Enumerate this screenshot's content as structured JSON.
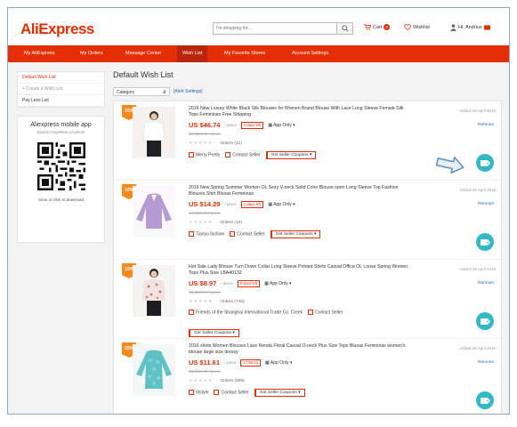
{
  "header": {
    "logo": "AliExpress",
    "search_placeholder": "I'm shopping for...",
    "cart_label": "Cart",
    "cart_count": "0",
    "wishlist_label": "Wishlist",
    "user_label": "Hi, Andrius"
  },
  "nav": {
    "items": [
      "My AliExpress",
      "My Orders",
      "Message Center",
      "Wish List",
      "My Favorite Stores",
      "Account Settings"
    ],
    "active": "Wish List"
  },
  "sidebar": {
    "links": [
      "Default Wish List",
      "+ Create a Wish List",
      "Pay Less List"
    ],
    "app_title": "Aliexpress mobile app",
    "app_subtitle": "Search Anywhere,Anytime!",
    "app_download": "Scan or click to download"
  },
  "main": {
    "title": "Default Wish List",
    "category_label": "Category",
    "alert_settings": "[Alert Settings]",
    "remove_label": "Remove",
    "coupon_label": "Get Seller Coupons",
    "contact_label": "Contact Seller",
    "app_only_label": "App Only",
    "unit_label": "/ piece",
    "colors": {
      "accent": "#e62e04",
      "ribbon": "#f7891a",
      "tag": "#33b8c8",
      "link": "#2364b8"
    },
    "items": [
      {
        "discount": "15%",
        "title": "2016 New Luxury White Black Silk Blouses for Women Brand Blouse With Lace Long Sleeve Female Silk Tops Feminines Free Shipping",
        "price": "US $46.74",
        "days_left": "1 days left",
        "old_price": "US $54.99 / piece",
        "orders": "Orders (12)",
        "store": "Merry Pretty",
        "added": "Added 26 April 2016"
      },
      {
        "discount": "10%",
        "title": "2016 New Spring Summer Women OL Sexy V-neck Solid Color Blouse open Long Sleeve Top Fashion Blouses Shirt Blusas Femininas",
        "price": "US $14.29",
        "days_left": "1 days left",
        "old_price": "US $15.88 / piece",
        "orders": "Orders (12)",
        "store": "Tianyu fashion",
        "added": "Added 26 April 2016"
      },
      {
        "discount": "15%",
        "title": "Hot Sale Lady Blouse Turn Down Collar Long Sleeve Printed Shirts Casual Office OL Loose Spring Women Tops Plus Size LBA40132",
        "price": "US $8.97",
        "days_left": "5 days left",
        "old_price": "US $10.55 / piece",
        "orders": "Orders (746)",
        "store": "Friends of the Shanghai International Trade Co. Creek",
        "added": "Added 26 April 2016"
      },
      {
        "discount": "25%",
        "title": "2016 shirts Women Blouses Lace Renda Floral Casual O-neck Plus Size Tops Blusas Femininas women's blouse large size dressy",
        "price": "US $11.61",
        "days_left": "17:58:54",
        "old_price": "US $15.48 / piece",
        "orders": "Orders (599)",
        "store": "Idstyle",
        "added": "Added 26 April 2016"
      }
    ]
  }
}
